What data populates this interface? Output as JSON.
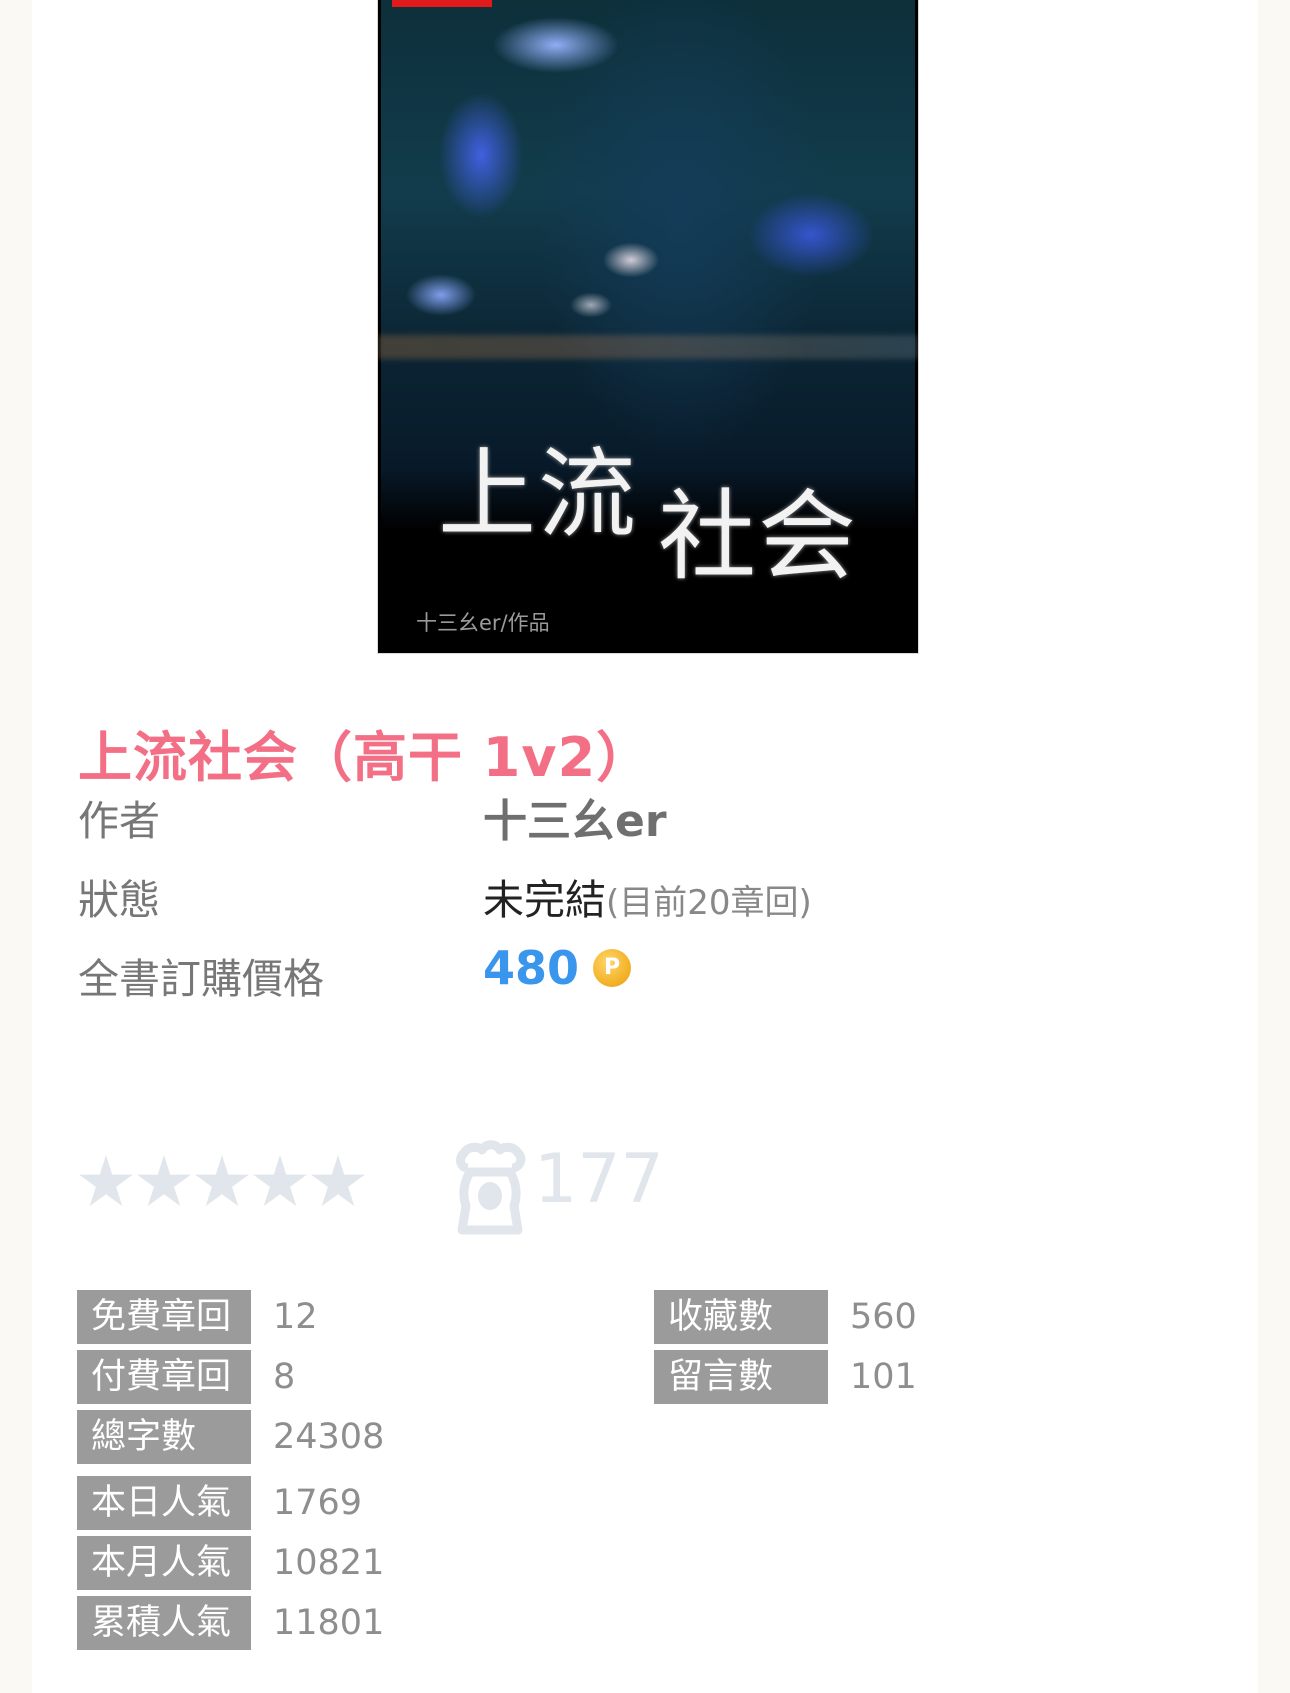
{
  "cover": {
    "title_chars_1": "上流",
    "title_chars_2": "社会",
    "author_credit": "十三幺er/作品"
  },
  "book": {
    "title": "上流社会（高干 1v2）"
  },
  "info": {
    "author_label": "作者",
    "author_value": "十三幺er",
    "status_label": "狀態",
    "status_value": "未完結",
    "status_detail": "(目前20章回)",
    "price_label": "全書訂購價格",
    "price_value": "480",
    "coin_symbol": "P"
  },
  "rating": {
    "stars_filled": 0,
    "stars_total": 5,
    "count": "177"
  },
  "stats_left": [
    {
      "label": "免費章回",
      "value": "12"
    },
    {
      "label": "付費章回",
      "value": "8"
    },
    {
      "label": "總字數",
      "value": "24308"
    },
    {
      "label": "本日人氣",
      "value": "1769"
    },
    {
      "label": "本月人氣",
      "value": "10821"
    },
    {
      "label": "累積人氣",
      "value": "11801"
    }
  ],
  "stats_right": [
    {
      "label": "收藏數",
      "value": "560"
    },
    {
      "label": "留言數",
      "value": "101"
    }
  ],
  "colors": {
    "title": "#f36f86",
    "price": "#3a95ec",
    "stat_label_bg": "#9b9b9b",
    "star_empty": "#e1e5ec"
  }
}
